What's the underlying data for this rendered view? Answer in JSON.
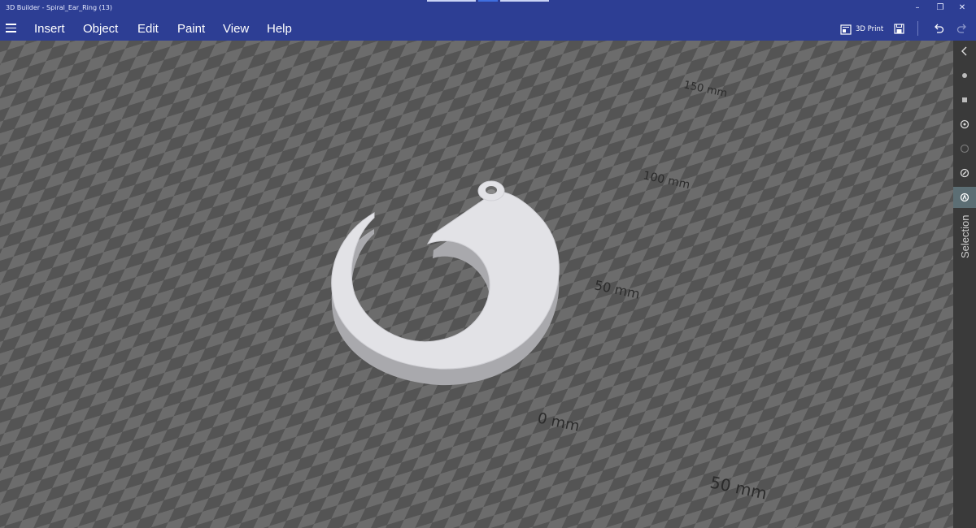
{
  "window": {
    "title": "3D Builder - Spiral_Ear_Ring (13)"
  },
  "menu": {
    "items": [
      "Insert",
      "Object",
      "Edit",
      "Paint",
      "View",
      "Help"
    ],
    "print_label": "3D Print"
  },
  "viewport": {
    "grid_labels": [
      "150 mm",
      "100 mm",
      "50 mm",
      "0 mm",
      "50 mm"
    ]
  },
  "side_panel": {
    "label": "Selection"
  },
  "colors": {
    "accent": "#2d3e94",
    "grid_light": "#6c6c6c",
    "grid_dark": "#545454",
    "model": "#e2e2e6"
  }
}
